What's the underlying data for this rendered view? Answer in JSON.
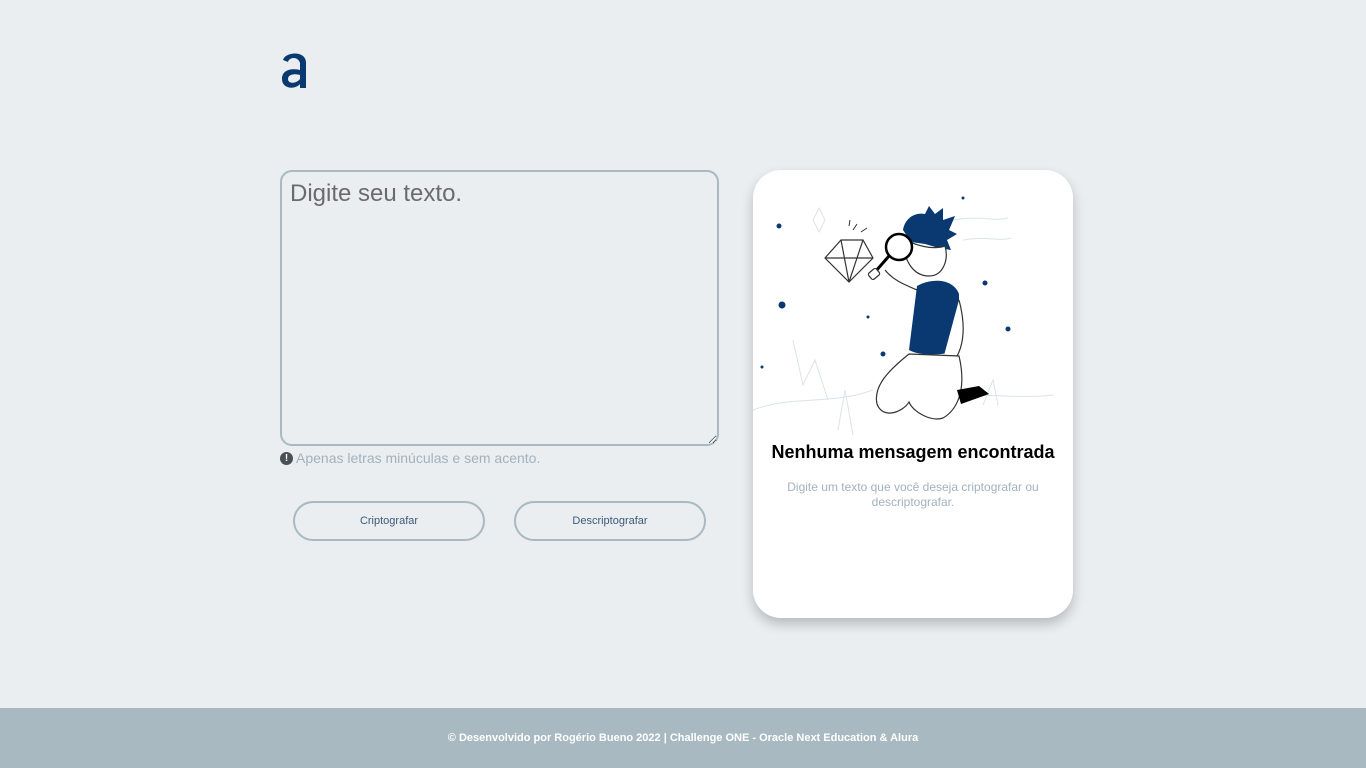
{
  "logo": {
    "icon": "alura-logo-icon",
    "color": "#0a3871"
  },
  "input": {
    "placeholder": "Digite seu texto.",
    "value": ""
  },
  "hint": {
    "icon": "exclamation-circle-icon",
    "text": "Apenas letras minúculas e sem acento."
  },
  "buttons": {
    "encrypt_label": "Criptografar",
    "decrypt_label": "Descriptografar"
  },
  "output": {
    "illustration": "person-magnifying-glass-illustration",
    "title": "Nenhuma mensagem encontrada",
    "description": "Digite um texto que você deseja criptografar ou descriptografar."
  },
  "footer": {
    "text": "© Desenvolvido por Rogério Bueno 2022 | Challenge ONE - Oracle Next Education & Alura"
  },
  "colors": {
    "accent": "#0a3871",
    "background": "#eaeef1",
    "border": "#a9b9c2",
    "muted_text": "#a3b2bd"
  }
}
